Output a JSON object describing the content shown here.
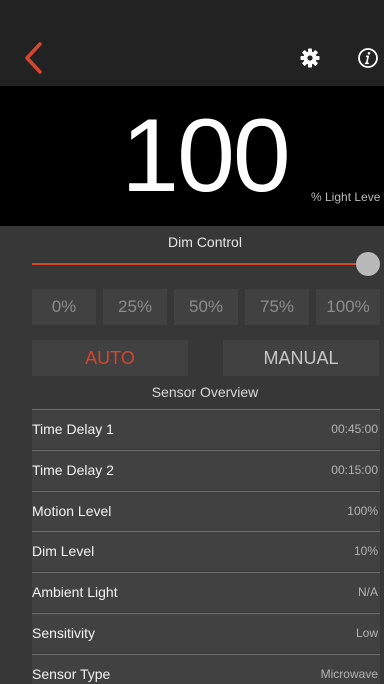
{
  "nav": {
    "back_icon": "chevron-left-icon",
    "settings_icon": "gear-icon",
    "info_icon": "info-icon",
    "accent_color": "#d6452d"
  },
  "light": {
    "level": "100",
    "unit": "% Light Leve"
  },
  "dim_control": {
    "label": "Dim Control",
    "slider_fraction": 1.0,
    "presets": [
      "0%",
      "25%",
      "50%",
      "75%",
      "100%"
    ]
  },
  "mode": {
    "auto_label": "AUTO",
    "manual_label": "MANUAL",
    "selected": "AUTO"
  },
  "sensor_overview": {
    "title": "Sensor Overview",
    "rows": [
      {
        "label": "Time Delay 1",
        "value": "00:45:00"
      },
      {
        "label": "Time Delay 2",
        "value": "00:15:00"
      },
      {
        "label": "Motion Level",
        "value": "100%"
      },
      {
        "label": "Dim Level",
        "value": "10%"
      },
      {
        "label": "Ambient Light",
        "value": "N/A"
      },
      {
        "label": "Sensitivity",
        "value": "Low"
      },
      {
        "label": "Sensor Type",
        "value": "Microwave"
      }
    ]
  }
}
